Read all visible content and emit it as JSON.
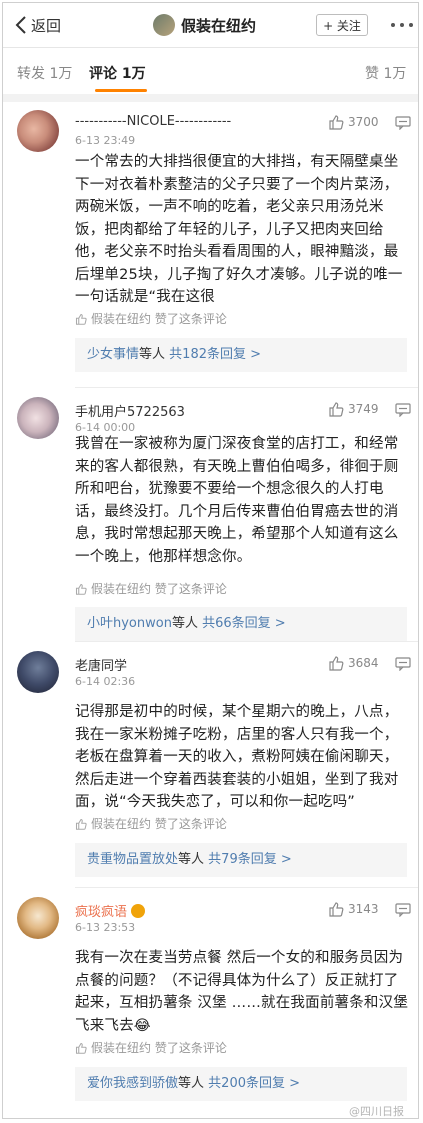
{
  "header": {
    "back_label": "返回",
    "title": "假装在纽约",
    "follow_label": "+ 关注"
  },
  "tabs": {
    "repost": "转发 1万",
    "comments": "评论 1万",
    "likes": "赞 1万"
  },
  "comments": [
    {
      "username": "-----------NICOLE------------",
      "time": "6-13 23:49",
      "likes": "3700",
      "text": "一个常去的大排挡很便宜的大排挡，有天隔壁桌坐下一对衣着朴素整洁的父子只要了一个肉片菜汤，两碗米饭，一声不响的吃着，老父亲只用汤兑米饭，把肉都给了年轻的儿子，儿子又把肉夹回给他，老父亲不时抬头看看周围的人，眼神黯淡，最后埋单25块，儿子掏了好久才凑够。儿子说的唯一一句话就是“我在这很",
      "liked_by": "假装在纽约 赞了这条评论",
      "reply_name": "少女事情",
      "reply_mid": "等人",
      "reply_count": "共182条回复 >"
    },
    {
      "username": "手机用户5722563",
      "time": "6-14 00:00",
      "likes": "3749",
      "text": "我曾在一家被称为厦门深夜食堂的店打工，和经常来的客人都很熟，有天晚上曹伯伯喝多，徘徊于厕所和吧台，犹豫要不要给一个想念很久的人打电话，最终没打。几个月后传来曹伯伯胃癌去世的消息，我时常想起那天晚上，希望那个人知道有这么一个晚上，他那样想念你。",
      "liked_by": "假装在纽约 赞了这条评论",
      "reply_name": "小叶hyonwon",
      "reply_mid": "等人",
      "reply_count": "共66条回复 >"
    },
    {
      "username": "老唐同学",
      "time": "6-14 02:36",
      "likes": "3684",
      "text": "记得那是初中的时候，某个星期六的晚上，八点，我在一家米粉摊子吃粉，店里的客人只有我一个，老板在盘算着一天的收入，煮粉阿姨在偷闲聊天，然后走进一个穿着西装套装的小姐姐，坐到了我对面，说“今天我失恋了，可以和你一起吃吗”",
      "liked_by": "假装在纽约 赞了这条评论",
      "reply_name": "贵重物品置放处",
      "reply_mid": "等人",
      "reply_count": "共79条回复 >"
    },
    {
      "username": "疯琰疯语",
      "time": "6-13 23:53",
      "likes": "3143",
      "text": "我有一次在麦当劳点餐 然后一个女的和服务员因为点餐的问题？（不记得具体为什么了）反正就打了起来，互相扔薯条 汉堡 ……就在我面前薯条和汉堡飞来飞去😂",
      "liked_by": "假装在纽约 赞了这条评论",
      "reply_name": "爱你我感到骄傲",
      "reply_mid": "等人",
      "reply_count": "共200条回复 >"
    }
  ],
  "watermark": "@四川日报"
}
